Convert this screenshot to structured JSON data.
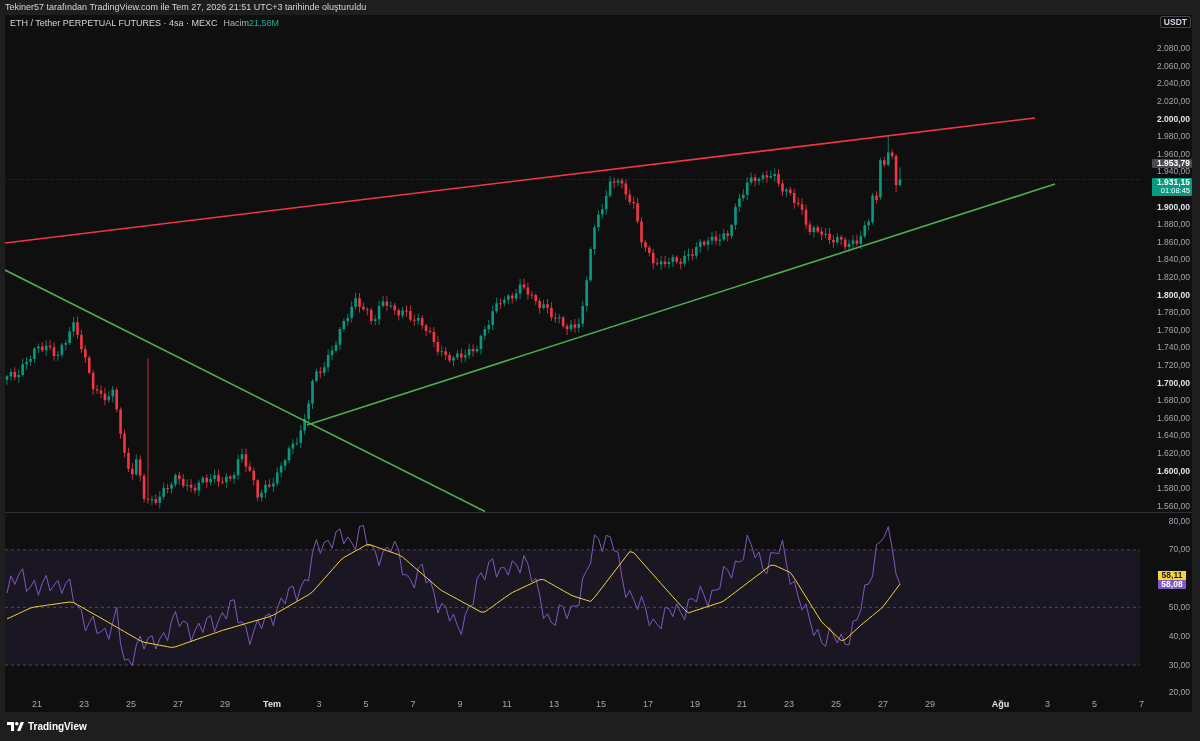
{
  "header": {
    "text": "Tekiner57 tarafından TradingView.com ile Tem 27, 2026 21:51 UTC+3 tarihinde oluşturuldu"
  },
  "legend": {
    "symbol": "ETH / Tether PERPETUAL FUTURES · 4sa · MEXC",
    "volume_label": "Hacim",
    "volume_value": "21,58M"
  },
  "price_axis": {
    "currency": "USDT",
    "ticks": [
      {
        "label": "2.080,00",
        "major": false
      },
      {
        "label": "2.060,00",
        "major": false
      },
      {
        "label": "2.040,00",
        "major": false
      },
      {
        "label": "2.020,00",
        "major": false
      },
      {
        "label": "2.000,00",
        "major": true
      },
      {
        "label": "1.980,00",
        "major": false
      },
      {
        "label": "1.960,00",
        "major": false
      },
      {
        "label": "1.940,00",
        "major": false
      },
      {
        "label": "1.900,00",
        "major": true
      },
      {
        "label": "1.880,00",
        "major": false
      },
      {
        "label": "1.860,00",
        "major": false
      },
      {
        "label": "1.840,00",
        "major": false
      },
      {
        "label": "1.820,00",
        "major": false
      },
      {
        "label": "1.800,00",
        "major": true
      },
      {
        "label": "1.780,00",
        "major": false
      },
      {
        "label": "1.760,00",
        "major": false
      },
      {
        "label": "1.740,00",
        "major": false
      },
      {
        "label": "1.720,00",
        "major": false
      },
      {
        "label": "1.700,00",
        "major": true
      },
      {
        "label": "1.680,00",
        "major": false
      },
      {
        "label": "1.660,00",
        "major": false
      },
      {
        "label": "1.640,00",
        "major": false
      },
      {
        "label": "1.620,00",
        "major": false
      },
      {
        "label": "1.600,00",
        "major": true
      },
      {
        "label": "1.580,00",
        "major": false
      },
      {
        "label": "1.560,00",
        "major": false
      }
    ],
    "markers": [
      {
        "kind": "secondary",
        "price": "1.953,79"
      },
      {
        "kind": "last",
        "price": "1.931,15",
        "countdown": "01:08:45"
      }
    ]
  },
  "rsi_axis": {
    "ticks": [
      {
        "label": "80,00"
      },
      {
        "label": "70,00"
      },
      {
        "label": "50,00"
      },
      {
        "label": "40,00"
      },
      {
        "label": "30,00"
      },
      {
        "label": "20,00"
      }
    ],
    "markers": [
      {
        "kind": "average",
        "value": "58,11",
        "color": "#f5d33b"
      },
      {
        "kind": "rsi",
        "value": "58,08",
        "color": "#7e57c2"
      }
    ]
  },
  "time_axis": {
    "labels": [
      {
        "label": "21",
        "major": false
      },
      {
        "label": "23",
        "major": false
      },
      {
        "label": "25",
        "major": false
      },
      {
        "label": "27",
        "major": false
      },
      {
        "label": "29",
        "major": false
      },
      {
        "label": "Tem",
        "major": true
      },
      {
        "label": "3",
        "major": false
      },
      {
        "label": "5",
        "major": false
      },
      {
        "label": "7",
        "major": false
      },
      {
        "label": "9",
        "major": false
      },
      {
        "label": "11",
        "major": false
      },
      {
        "label": "13",
        "major": false
      },
      {
        "label": "15",
        "major": false
      },
      {
        "label": "17",
        "major": false
      },
      {
        "label": "19",
        "major": false
      },
      {
        "label": "21",
        "major": false
      },
      {
        "label": "23",
        "major": false
      },
      {
        "label": "25",
        "major": false
      },
      {
        "label": "27",
        "major": false
      },
      {
        "label": "29",
        "major": false
      },
      {
        "label": "Ağu",
        "major": true
      },
      {
        "label": "3",
        "major": false
      },
      {
        "label": "5",
        "major": false
      },
      {
        "label": "7",
        "major": false
      }
    ]
  },
  "footer": {
    "logo_text": "TradingView"
  }
}
